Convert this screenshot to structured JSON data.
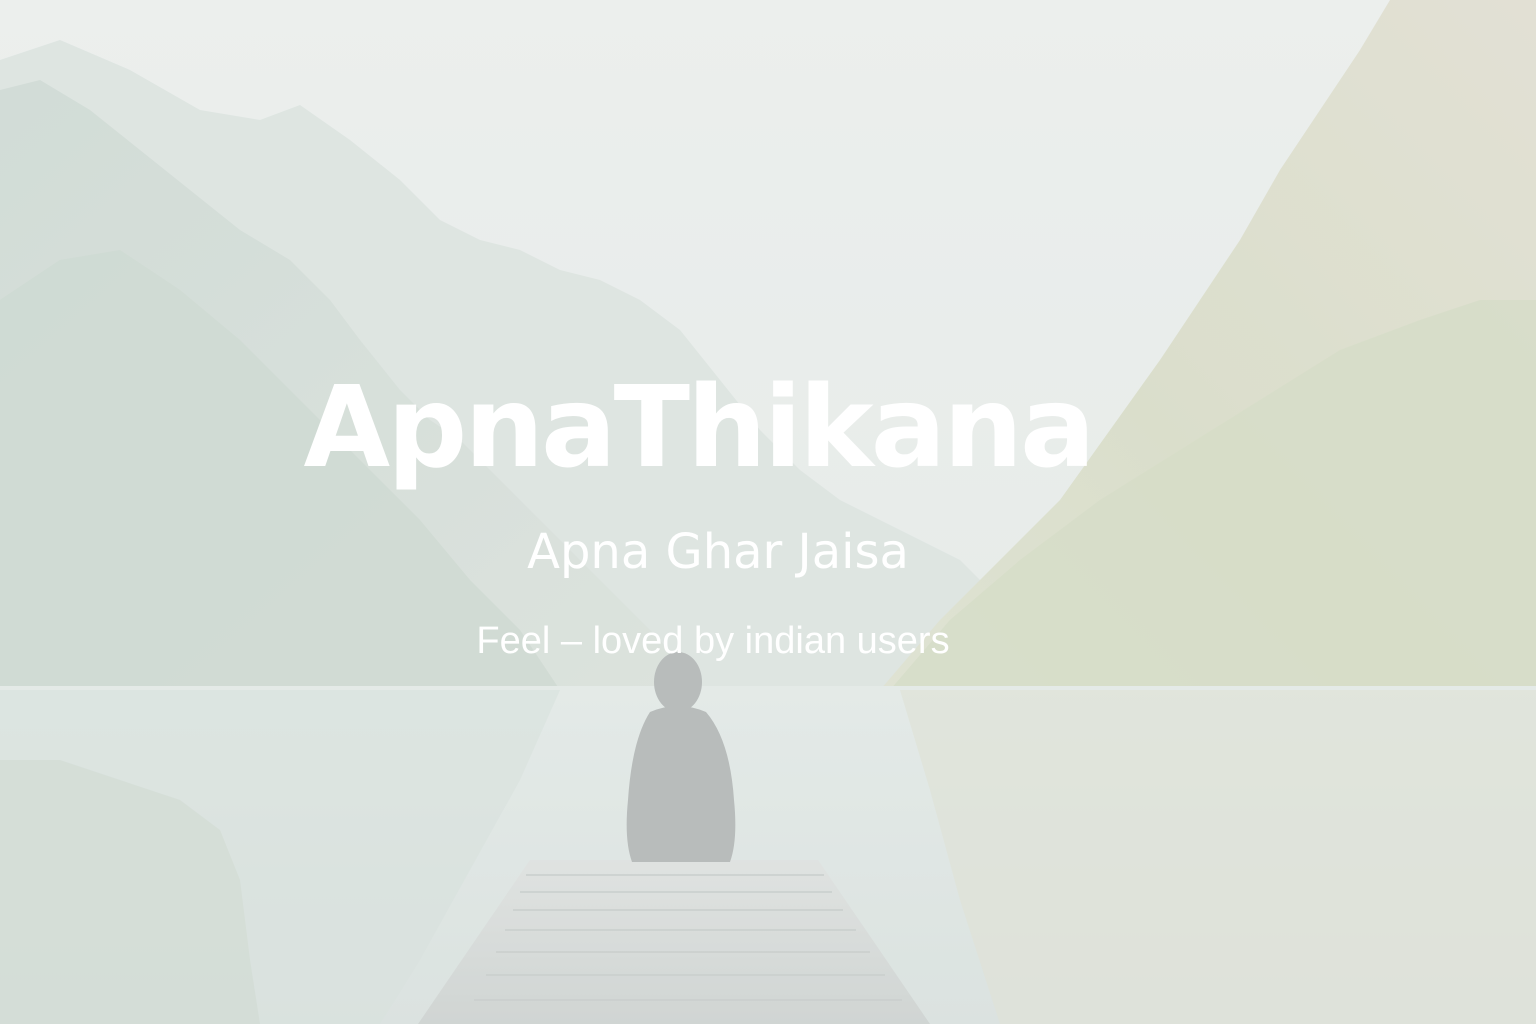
{
  "hero": {
    "title": "ApnaThikana",
    "tagline": "Apna Ghar Jaisa",
    "subline": "Feel – loved by indian users"
  },
  "colors": {
    "sky": "#e9eceb",
    "mountain_far": "#d4dcda",
    "mountain_left": "#c9d5cf",
    "mountain_right": "#d6d7c4",
    "forest_right": "#cfd6b8",
    "water": "#d7e0df",
    "dock": "#cdd1d0",
    "figure": "#9ea3a4",
    "text": "#ffffff"
  },
  "icons": {
    "background": "mountain-lake-scene"
  }
}
